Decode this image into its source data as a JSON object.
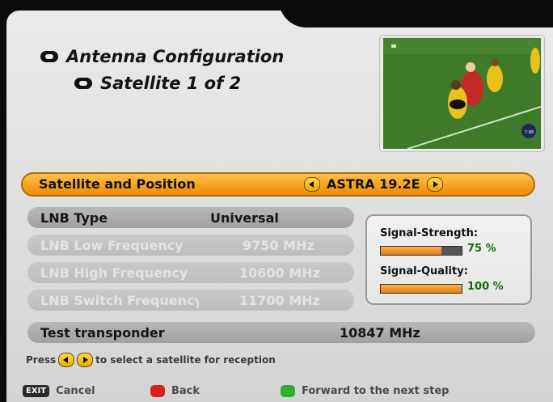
{
  "header": {
    "title": "Antenna Configuration",
    "subtitle": "Satellite 1 of 2"
  },
  "satellite_row": {
    "label": "Satellite and Position",
    "value": "ASTRA 19.2E"
  },
  "settings": [
    {
      "label": "LNB Type",
      "value": "Universal",
      "enabled": true
    },
    {
      "label": "LNB Low Frequency",
      "value": "9750 MHz",
      "enabled": false
    },
    {
      "label": "LNB High Frequency",
      "value": "10600 MHz",
      "enabled": false
    },
    {
      "label": "LNB Switch Frequency",
      "value": "11700 MHz",
      "enabled": false
    }
  ],
  "signal": {
    "strength_label": "Signal-Strength:",
    "strength_value": "75 %",
    "strength_level": 0.75,
    "quality_label": "Signal-Quality:",
    "quality_value": "100 %",
    "quality_level": 1.0
  },
  "transponder": {
    "label": "Test transponder",
    "value": "10847 MHz"
  },
  "hint": {
    "before": "Press",
    "after": "to select a satellite for reception"
  },
  "footer": {
    "exit_key": "EXIT",
    "cancel": "Cancel",
    "back": "Back",
    "forward": "Forward to the next step"
  },
  "colors": {
    "accent": "#f6a21d",
    "red_button": "#d82020",
    "green_button": "#2eae2e",
    "value_green": "#146b14"
  }
}
